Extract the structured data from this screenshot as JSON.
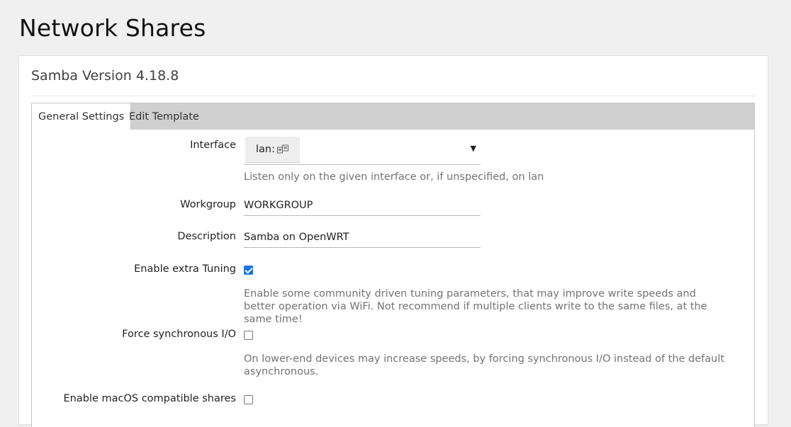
{
  "page": {
    "title": "Network Shares"
  },
  "card": {
    "title": "Samba Version 4.18.8"
  },
  "tabs": [
    {
      "label": "General Settings",
      "active": true
    },
    {
      "label": "Edit Template",
      "active": false
    }
  ],
  "form": {
    "interface": {
      "label": "Interface",
      "value": "lan:",
      "icon": "network-ports-icon",
      "help": "Listen only on the given interface or, if unspecified, on lan"
    },
    "workgroup": {
      "label": "Workgroup",
      "value": "WORKGROUP"
    },
    "description": {
      "label": "Description",
      "value": "Samba on OpenWRT"
    },
    "extra_tuning": {
      "label": "Enable extra Tuning",
      "checked": true,
      "help": "Enable some community driven tuning parameters, that may improve write speeds and better operation via WiFi. Not recommend if multiple clients write to the same files, at the same time!"
    },
    "force_sync": {
      "label": "Force synchronous I/O",
      "checked": false,
      "help": "On lower-end devices may increase speeds, by forcing synchronous I/O instead of the default asynchronous."
    },
    "macos": {
      "label": "Enable macOS compatible shares",
      "checked": false
    }
  },
  "colors": {
    "accent": "#1a73e8",
    "tabbar": "#cfcfcf",
    "background": "#f0f0f0"
  }
}
